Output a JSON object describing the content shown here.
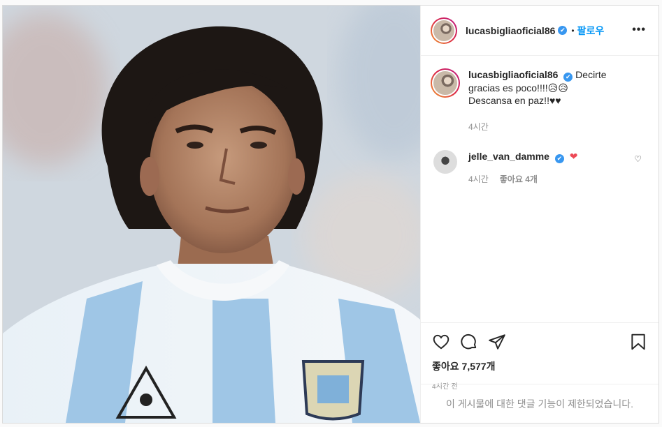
{
  "post": {
    "author": "lucasbigliaoficial86",
    "follow_label": "팔로우",
    "dot": "•",
    "more_label": "•••",
    "verified_mark": "✔"
  },
  "caption": {
    "user": "lucasbigliaoficial86",
    "text_line1": "Decirte gracias es poco!!!!😥😥",
    "text_line2": "Descansa en paz!!♥♥",
    "time": "4시간"
  },
  "comments": [
    {
      "user": "jelle_van_damme",
      "text": "❤",
      "time": "4시간",
      "likes": "좋아요 4개",
      "like_icon": "♡"
    }
  ],
  "actions": {
    "likes": "좋아요 7,577개",
    "posted": "4시간 전"
  },
  "footer": {
    "disabled_text": "이 게시물에 대한 댓글 기능이 제한되었습니다."
  },
  "colors": {
    "accent": "#0095f6",
    "verified": "#3897f0",
    "heart": "#ed4956",
    "muted": "#8e8e8e"
  }
}
